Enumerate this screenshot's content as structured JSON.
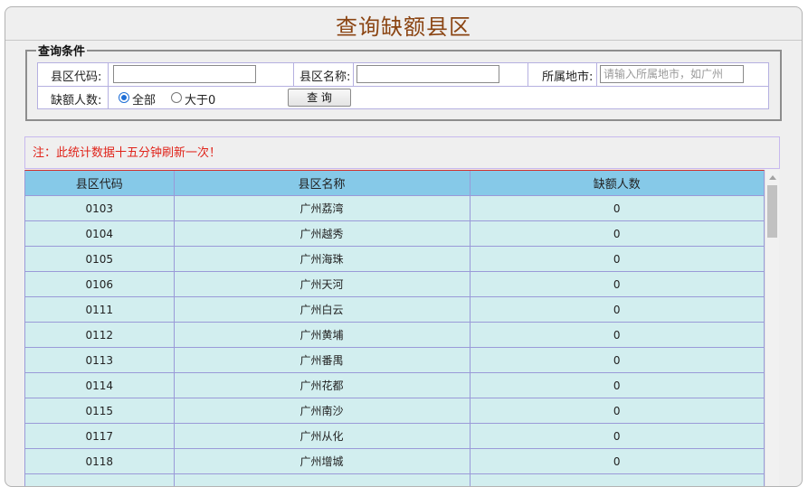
{
  "title": "查询缺额县区",
  "conditions": {
    "legend": "查询条件",
    "district_code_label": "县区代码:",
    "district_code_value": "",
    "district_name_label": "县区名称:",
    "district_name_value": "",
    "city_label": "所属地市:",
    "city_placeholder": "请输入所属地市，如广州",
    "vacancy_label": "缺额人数:",
    "radio_all_label": "全部",
    "radio_gt0_label": "大于0",
    "radio_selected": "全部",
    "search_button": "查 询"
  },
  "notice": "注：此统计数据十五分钟刷新一次！",
  "table": {
    "headers": [
      "县区代码",
      "县区名称",
      "缺额人数"
    ],
    "rows": [
      [
        "0103",
        "广州荔湾",
        "0"
      ],
      [
        "0104",
        "广州越秀",
        "0"
      ],
      [
        "0105",
        "广州海珠",
        "0"
      ],
      [
        "0106",
        "广州天河",
        "0"
      ],
      [
        "0111",
        "广州白云",
        "0"
      ],
      [
        "0112",
        "广州黄埔",
        "0"
      ],
      [
        "0113",
        "广州番禺",
        "0"
      ],
      [
        "0114",
        "广州花都",
        "0"
      ],
      [
        "0115",
        "广州南沙",
        "0"
      ],
      [
        "0117",
        "广州从化",
        "0"
      ],
      [
        "0118",
        "广州增城",
        "0"
      ],
      [
        "",
        "",
        ""
      ]
    ]
  },
  "icons": {
    "scroll_up": "triangle-up-icon",
    "radio": "radio-icon"
  },
  "colors": {
    "title": "#8b4513",
    "notice": "#e0241b",
    "header_bg": "#86c9e8",
    "row_bg": "#d2eeef"
  }
}
